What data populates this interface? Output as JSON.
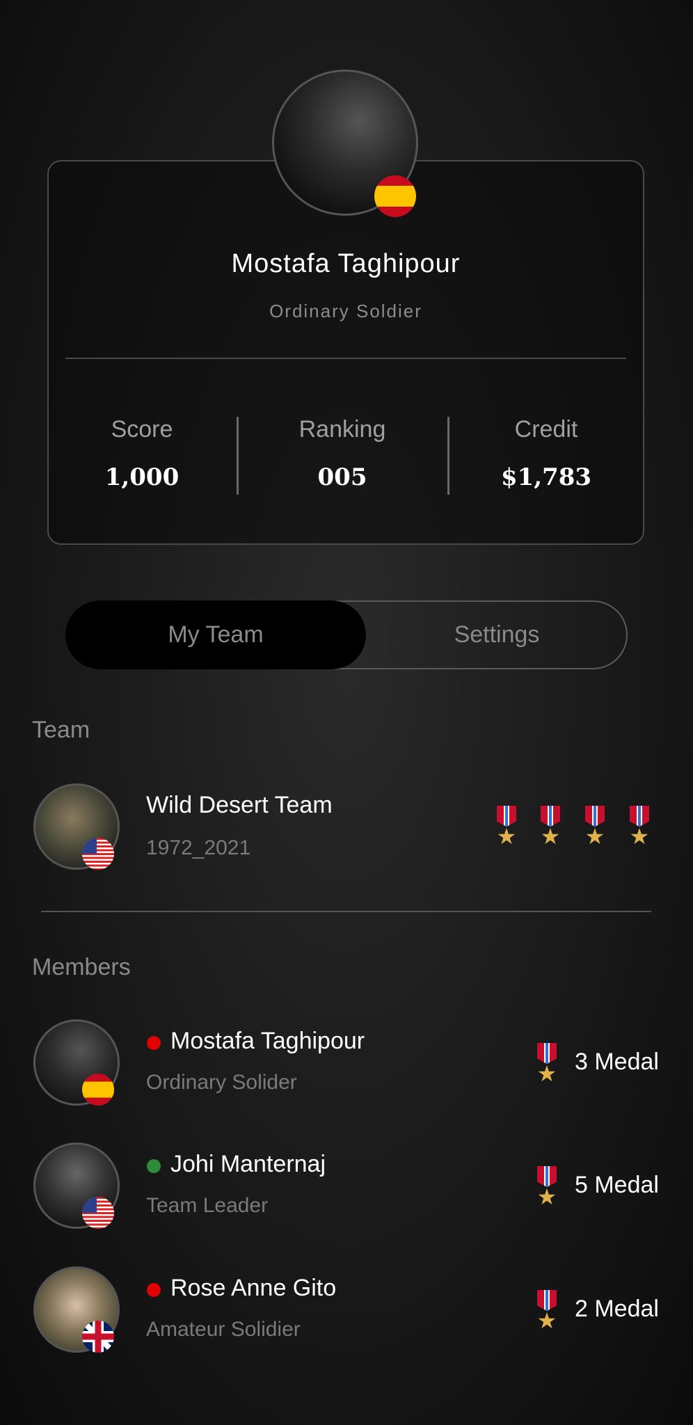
{
  "profile": {
    "name": "Mostafa Taghipour",
    "rank": "Ordinary Soldier",
    "flag": "spain-flag",
    "stats": [
      {
        "label": "Score",
        "value": "1,000"
      },
      {
        "label": "Ranking",
        "value": "005"
      },
      {
        "label": "Credit",
        "value": "$1,783"
      }
    ]
  },
  "tabs": [
    {
      "label": "My Team",
      "active": true
    },
    {
      "label": "Settings",
      "active": false
    }
  ],
  "team": {
    "section_title": "Team",
    "name": "Wild Desert Team",
    "subtitle": "1972_2021",
    "flag": "usa-flag",
    "medals": 4
  },
  "members": {
    "section_title": "Members",
    "items": [
      {
        "name": "Mostafa Taghipour",
        "role": "Ordinary Solider",
        "status_color": "#e00000",
        "flag": "spain-flag",
        "medals": "3 Medal"
      },
      {
        "name": "Johi Manternaj",
        "role": "Team Leader",
        "status_color": "#2e8b3a",
        "flag": "usa-flag",
        "medals": "5 Medal"
      },
      {
        "name": "Rose Anne Gito",
        "role": "Amateur Solidier",
        "status_color": "#e00000",
        "flag": "uk-flag",
        "medals": "2 Medal"
      }
    ]
  },
  "colors": {
    "background": "#1a1a1a",
    "medal_ribbon": "#c8102e",
    "medal_star": "#e0b04a"
  }
}
